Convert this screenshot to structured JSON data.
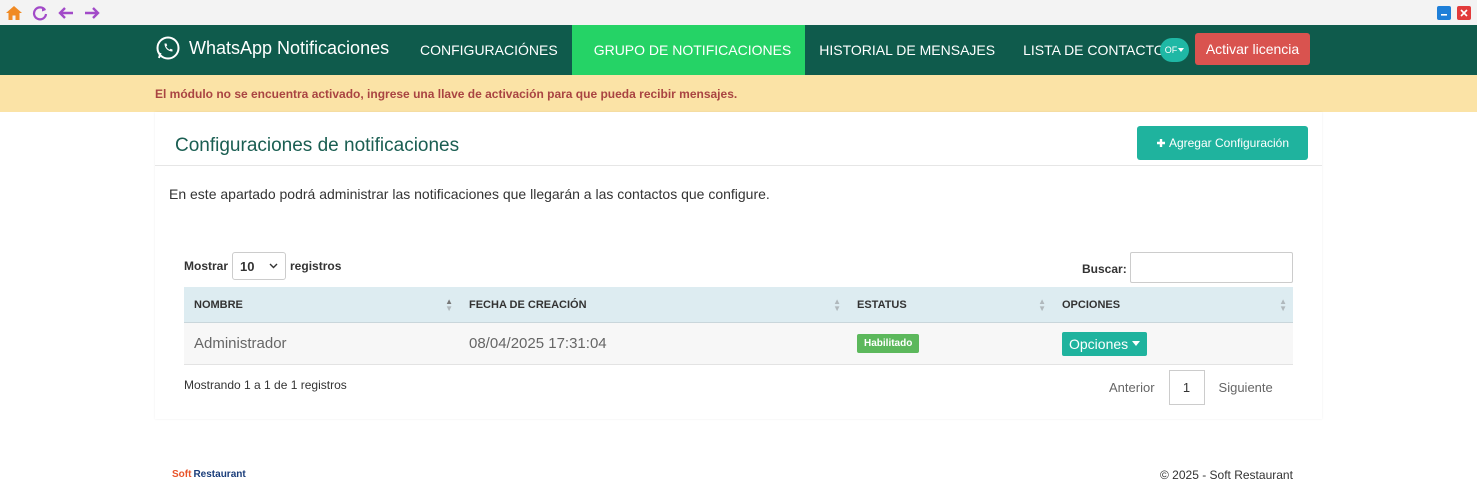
{
  "chrome": {
    "icons": [
      "home-icon",
      "refresh-icon",
      "back-arrow-icon",
      "forward-arrow-icon"
    ],
    "window_buttons": [
      "minimize-icon",
      "close-icon"
    ]
  },
  "navbar": {
    "brand": "WhatsApp Notificaciones",
    "items": [
      {
        "label": "CONFIGURACIÓNES",
        "active": false
      },
      {
        "label": "GRUPO DE NOTIFICACIONES",
        "active": true
      },
      {
        "label": "HISTORIAL DE MENSAJES",
        "active": false
      },
      {
        "label": "LISTA DE CONTACTOS",
        "active": false
      }
    ],
    "user_initials": "OF",
    "activate_label": "Activar licencia",
    "colors": {
      "bar": "#0f5b4c",
      "active": "#25d366",
      "danger": "#d9534f"
    }
  },
  "alert": {
    "text": "El módulo no se encuentra activado, ingrese una llave de activación para que pueda recibir mensajes."
  },
  "panel": {
    "title": "Configuraciones de notificaciones",
    "add_label": "Agregar Configuración",
    "description": "En este apartado podrá administrar las notificaciones que llegarán a las contactos que configure."
  },
  "table": {
    "show_label": "Mostrar",
    "page_size": "10",
    "records_label": "registros",
    "search_label": "Buscar:",
    "search_value": "",
    "columns": [
      "NOMBRE",
      "FECHA DE CREACIÓN",
      "ESTATUS",
      "OPCIONES"
    ],
    "rows": [
      {
        "name": "Administrador",
        "created": "08/04/2025 17:31:04",
        "status": "Habilitado",
        "options_label": "Opciones"
      }
    ],
    "info": "Mostrando 1 a 1 de 1 registros",
    "pager": {
      "prev": "Anterior",
      "current": "1",
      "next": "Siguiente"
    }
  },
  "footer": {
    "logo_part1": "Soft",
    "logo_part2": "Restaurant",
    "copyright": "© 2025 - Soft Restaurant"
  }
}
